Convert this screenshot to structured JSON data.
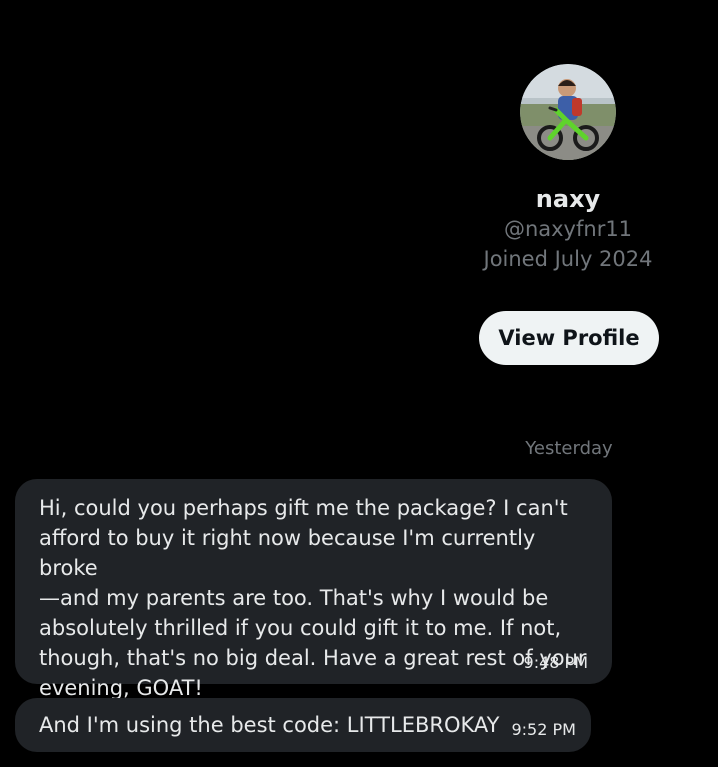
{
  "profile": {
    "display_name": "naxy",
    "handle": "@naxyfnr11",
    "joined": "Joined July 2024",
    "view_profile_label": "View Profile"
  },
  "conversation": {
    "date_divider": "Yesterday",
    "messages": [
      {
        "text": "Hi, could you perhaps gift me the package? I can't\nafford to buy it right now because I'm currently broke\n—and my parents are too. That's why I would be\nabsolutely thrilled if you could gift it to me. If not,\nthough, that's no big deal. Have a great rest of your\nevening, GOAT!",
        "time": "9:48 PM"
      },
      {
        "text": "And I'm using the best code: LITTLEBROKAY",
        "time": "9:52 PM"
      }
    ]
  },
  "colors": {
    "background": "#000000",
    "bubble": "#202327",
    "primary_text": "#e7e9ea",
    "secondary_text": "#71767b",
    "button_bg": "#eff3f4",
    "button_text": "#0f1419"
  }
}
